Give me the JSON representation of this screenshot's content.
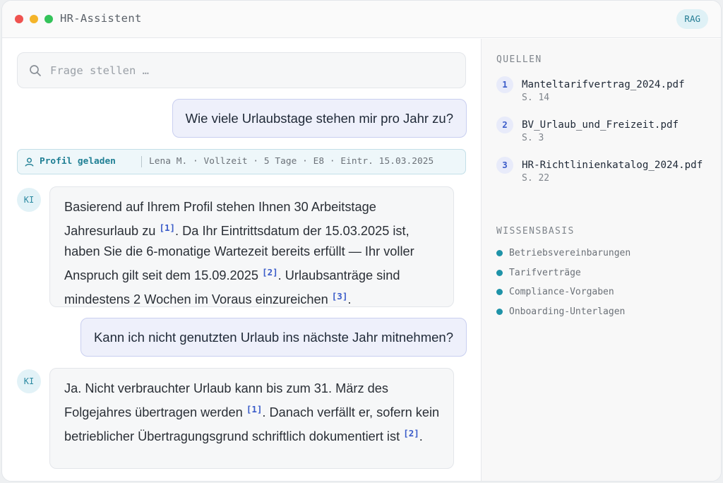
{
  "window": {
    "title": "HR-Assistent",
    "badge": "RAG"
  },
  "search": {
    "placeholder": "Frage stellen …"
  },
  "messages": {
    "q1": "Wie viele Urlaubstage stehen mir pro Jahr zu?",
    "profile": {
      "label": "Profil geladen",
      "details": "Lena M. ·  Vollzeit · 5 Tage ·  E8 ·  Eintr. 15.03.2025"
    },
    "avatar": "KI",
    "a1": {
      "t1": "Basierend auf Ihrem Profil stehen Ihnen 30 Arbeitstage Jahresurlaub zu ",
      "c1": "[1]",
      "t2": ". Da Ihr Eintrittsdatum der 15.03.2025 ist, haben Sie die 6-monatige Wartezeit bereits erfüllt — Ihr voller Anspruch gilt seit dem 15.09.2025 ",
      "c2": "[2]",
      "t3": ". Urlaubsanträge sind mindestens 2 Wochen im Voraus einzureichen ",
      "c3": "[3]",
      "t4": "."
    },
    "q2": "Kann ich nicht genutzten Urlaub ins nächste Jahr mitnehmen?",
    "a2": {
      "t1": "Ja. Nicht verbrauchter Urlaub kann bis zum 31. März des Folgejahres übertragen werden ",
      "c1": "[1]",
      "t2": ". Danach verfällt er, sofern kein betrieblicher Übertragungsgrund schriftlich dokumentiert ist ",
      "c2": "[2]",
      "t3": "."
    }
  },
  "sidebar": {
    "sources_title": "QUELLEN",
    "sources": [
      {
        "num": "1",
        "name": "Manteltarifvertrag_2024.pdf",
        "page": "S. 14"
      },
      {
        "num": "2",
        "name": "BV_Urlaub_und_Freizeit.pdf",
        "page": "S. 3"
      },
      {
        "num": "3",
        "name": "HR-Richtlinienkatalog_2024.pdf",
        "page": "S. 22"
      }
    ],
    "kb_title": "WISSENSBASIS",
    "kb_items": [
      "Betriebsvereinbarungen",
      "Tarifverträge",
      "Compliance-Vorgaben",
      "Onboarding-Unterlagen"
    ],
    "colors": {
      "accent": "#1f93a8",
      "citation": "#3b5cc9"
    }
  }
}
